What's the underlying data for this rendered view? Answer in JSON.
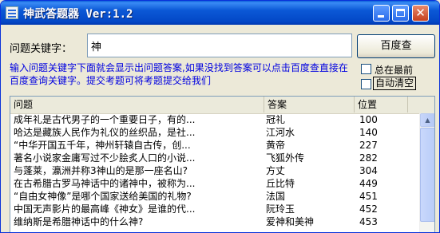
{
  "window": {
    "title": "神武答题器 Ver:1.2",
    "buttons": {
      "minimize": "minimize-icon",
      "maximize": "maximize-icon",
      "close": "close-icon",
      "close_glyph": "✕"
    }
  },
  "search": {
    "label": "问题关键字：",
    "value": "神",
    "button_label": "百度查"
  },
  "hint": "输入问题关键字下面就会显示出问题答案,如果没找到答案可以点击百度查直接在百度查询关键字。提交考题可将考题提交给我们",
  "options": {
    "always_on_top": {
      "label": "总在最前",
      "checked": false
    },
    "auto_clear": {
      "label": "自动清空",
      "checked": false
    }
  },
  "table": {
    "columns": [
      "问题",
      "答案",
      "位置"
    ],
    "rows": [
      {
        "q": "成年礼是古代男子的一个重要日子，有的...",
        "a": "冠礼",
        "p": "100"
      },
      {
        "q": "哈达是藏族人民作为礼仪的丝织品，是社...",
        "a": "江河水",
        "p": "140"
      },
      {
        "q": "“中华开国五千年，神州轩辕自古传，创...",
        "a": "黄帝",
        "p": "227"
      },
      {
        "q": "著名小说家金庸写过不少脍炙人口的小说...",
        "a": "飞狐外传",
        "p": "282"
      },
      {
        "q": "与蓬莱，瀛洲并称3神山的是那一座名山?",
        "a": "方丈",
        "p": "304"
      },
      {
        "q": "在古希腊古罗马神话中的诸神中，被称为...",
        "a": "丘比特",
        "p": "449"
      },
      {
        "q": "“自由女神像”是哪个国家送给美国的礼物?",
        "a": "法国",
        "p": "451"
      },
      {
        "q": "中国无声影片的最高峰《神女》是谁的代...",
        "a": "阮玲玉",
        "p": "452"
      },
      {
        "q": "维纳斯是希腊神话中的什么神?",
        "a": "爱神和美神",
        "p": "453"
      }
    ]
  },
  "scrollbar": {
    "up_glyph": "▲"
  }
}
